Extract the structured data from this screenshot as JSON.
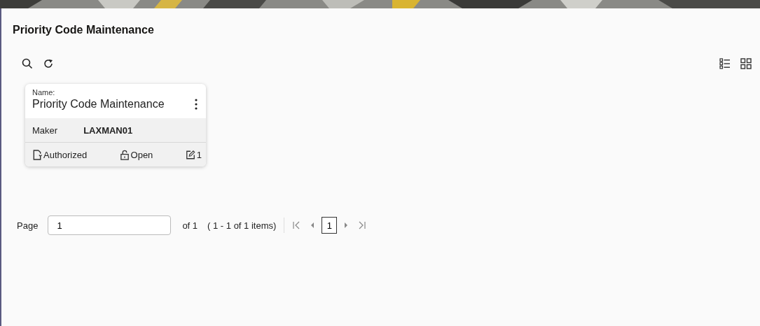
{
  "page": {
    "title": "Priority Code Maintenance"
  },
  "cards": [
    {
      "name_label": "Name:",
      "name": "Priority Code Maintenance",
      "maker_label": "Maker",
      "maker": "LAXMAN01",
      "status": "Authorized",
      "lock": "Open",
      "mod_count": "1"
    }
  ],
  "pagination": {
    "label": "Page",
    "value": "1",
    "of": "of 1",
    "range": "( 1 - 1 of 1 items)",
    "current_page": "1"
  }
}
